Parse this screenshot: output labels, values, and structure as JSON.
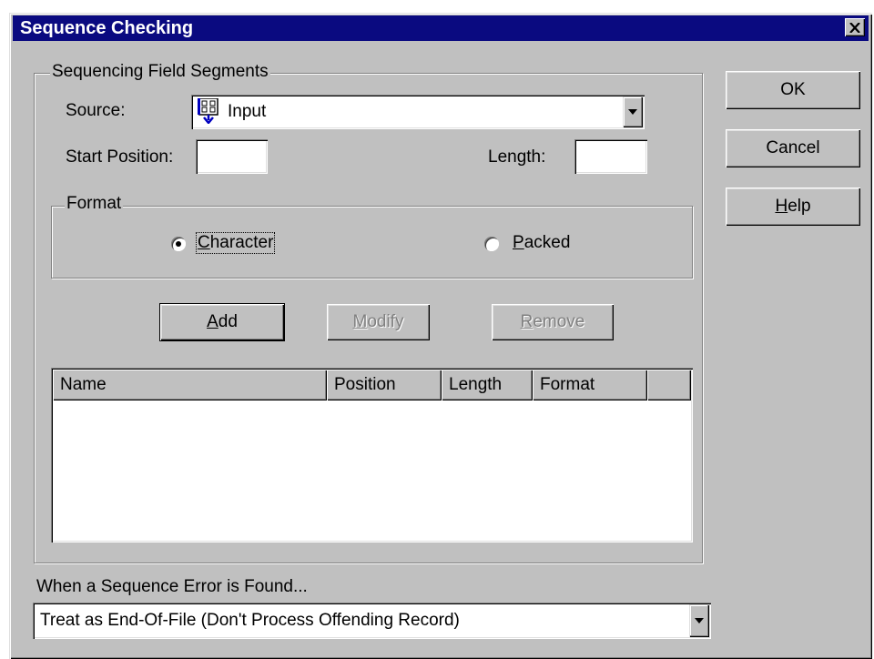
{
  "window": {
    "title": "Sequence Checking",
    "close_glyph": "×"
  },
  "segments": {
    "group_label": "Sequencing Field Segments",
    "source_label": "Source:",
    "source_value": "Input",
    "source_icon": "input-source-icon",
    "start_position_label": "Start Position:",
    "start_position_value": "",
    "length_label": "Length:",
    "length_value": ""
  },
  "format": {
    "group_label": "Format",
    "options": [
      {
        "label": "Character",
        "selected": true
      },
      {
        "label": "Packed",
        "selected": false
      }
    ]
  },
  "actions": {
    "add": "Add",
    "modify": "Modify",
    "remove": "Remove"
  },
  "table": {
    "columns": [
      "Name",
      "Position",
      "Length",
      "Format"
    ],
    "rows": []
  },
  "error": {
    "label": "When a Sequence Error is Found...",
    "selected": "Treat as End-Of-File (Don't Process Offending Record)"
  },
  "dialog_buttons": {
    "ok": "OK",
    "cancel": "Cancel",
    "help": "Help"
  },
  "colors": {
    "titlebar": "#0a0a80",
    "face": "#c0c0c0"
  }
}
